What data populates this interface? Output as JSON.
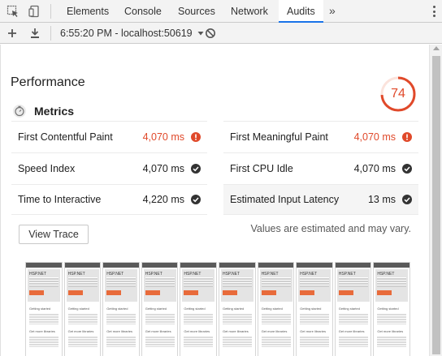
{
  "tabs": [
    {
      "label": "Elements",
      "active": false
    },
    {
      "label": "Console",
      "active": false
    },
    {
      "label": "Sources",
      "active": false
    },
    {
      "label": "Network",
      "active": false
    },
    {
      "label": "Audits",
      "active": true
    }
  ],
  "more_tabs": "»",
  "toolbar": {
    "report_label": "6:55:20 PM - localhost:50619",
    "icons": [
      "plus-icon",
      "download-icon",
      "dropdown-caret-icon",
      "clear-icon"
    ]
  },
  "category": {
    "title": "Performance",
    "score": "74",
    "score_fraction": 0.74,
    "score_color": "#e0492a"
  },
  "metrics": {
    "title": "Metrics",
    "items": [
      {
        "label": "First Contentful Paint",
        "value": "4,070 ms",
        "status": "warn"
      },
      {
        "label": "First Meaningful Paint",
        "value": "4,070 ms",
        "status": "warn"
      },
      {
        "label": "Speed Index",
        "value": "4,070 ms",
        "status": "pass"
      },
      {
        "label": "First CPU Idle",
        "value": "4,070 ms",
        "status": "pass"
      },
      {
        "label": "Time to Interactive",
        "value": "4,220 ms",
        "status": "pass"
      },
      {
        "label": "Estimated Input Latency",
        "value": "13 ms",
        "status": "pass"
      }
    ]
  },
  "view_trace_label": "View Trace",
  "estimate_note": "Values are estimated and may vary.",
  "filmstrip": {
    "frame_count": 10,
    "frame_title": "HSP.NET",
    "frame_sub1": "Getting started",
    "frame_sub2": "Get more libraries"
  },
  "colors": {
    "warn": "#e0492a",
    "pass": "#333333",
    "accent": "#1a73e8"
  }
}
